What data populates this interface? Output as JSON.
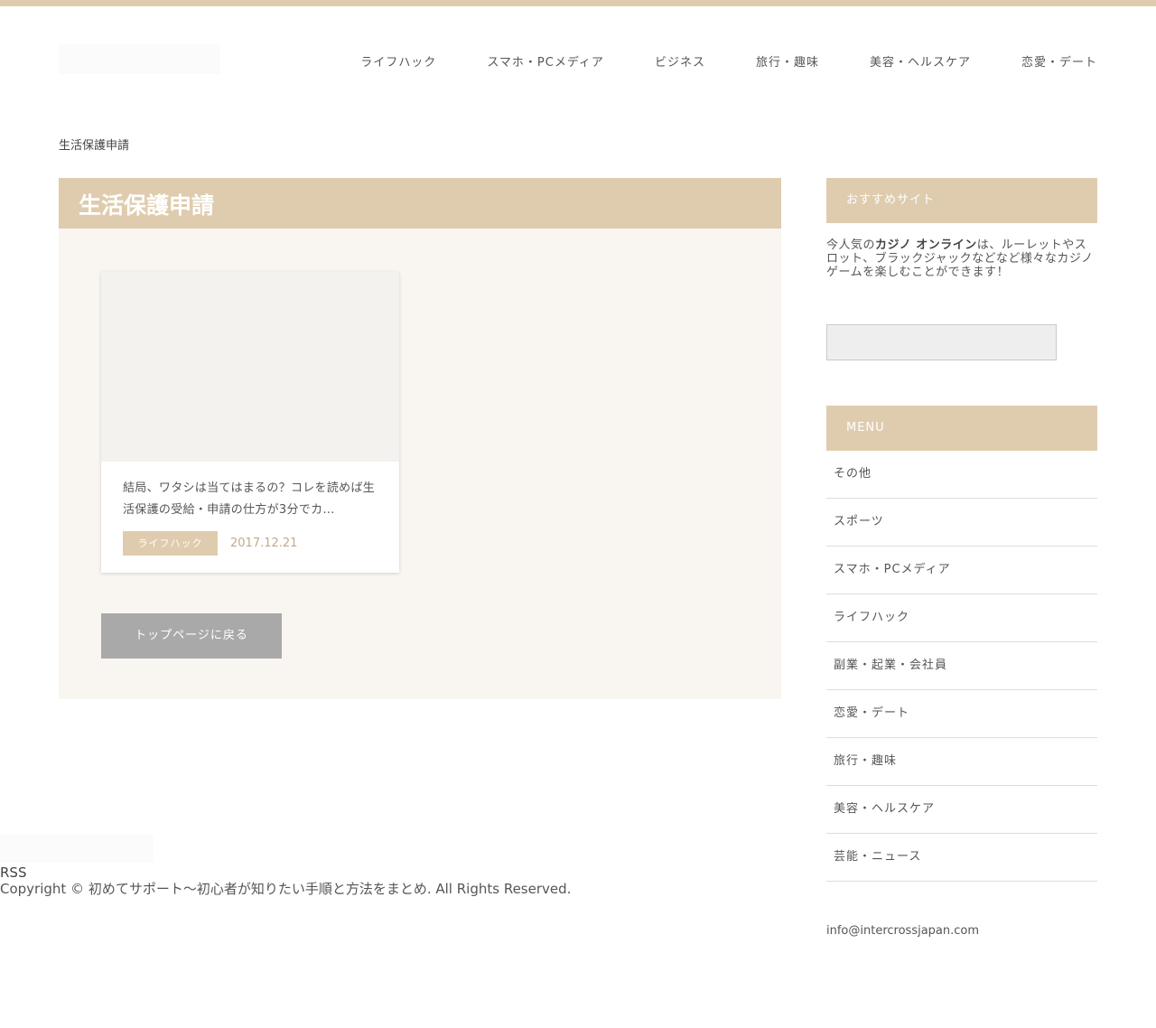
{
  "header": {
    "nav": [
      "ライフハック",
      "スマホ・PCメディア",
      "ビジネス",
      "旅行・趣味",
      "美容・ヘルスケア",
      "恋愛・デート"
    ]
  },
  "breadcrumb": "生活保護申請",
  "main": {
    "title": "生活保護申請",
    "card": {
      "title": "結局、ワタシは当てはまるの？コレを読めば生活保護の受給・申請の仕方が3分でカ…",
      "category": "ライフハック",
      "date": "2017.12.21"
    },
    "back_button": "トップページに戻る"
  },
  "sidebar": {
    "recommend_title": "おすすめサイト",
    "recommend_pre": "今人気の",
    "recommend_bold": "カジノ オンライン",
    "recommend_post": "は、ルーレットやスロット、ブラックジャックなどなど様々なカジノゲームを楽しむことができます！",
    "menu_title": "MENU",
    "menu_items": [
      "その他",
      "スポーツ",
      "スマホ・PCメディア",
      "ライフハック",
      "副業・起業・会社員",
      "恋愛・デート",
      "旅行・趣味",
      "美容・ヘルスケア",
      "芸能・ニュース"
    ],
    "email": "info@intercrossjapan.com"
  },
  "footer": {
    "rss": "RSS",
    "copyright": "Copyright © 初めてサポート〜初心者が知りたい手順と方法をまとめ. All Rights Reserved."
  }
}
